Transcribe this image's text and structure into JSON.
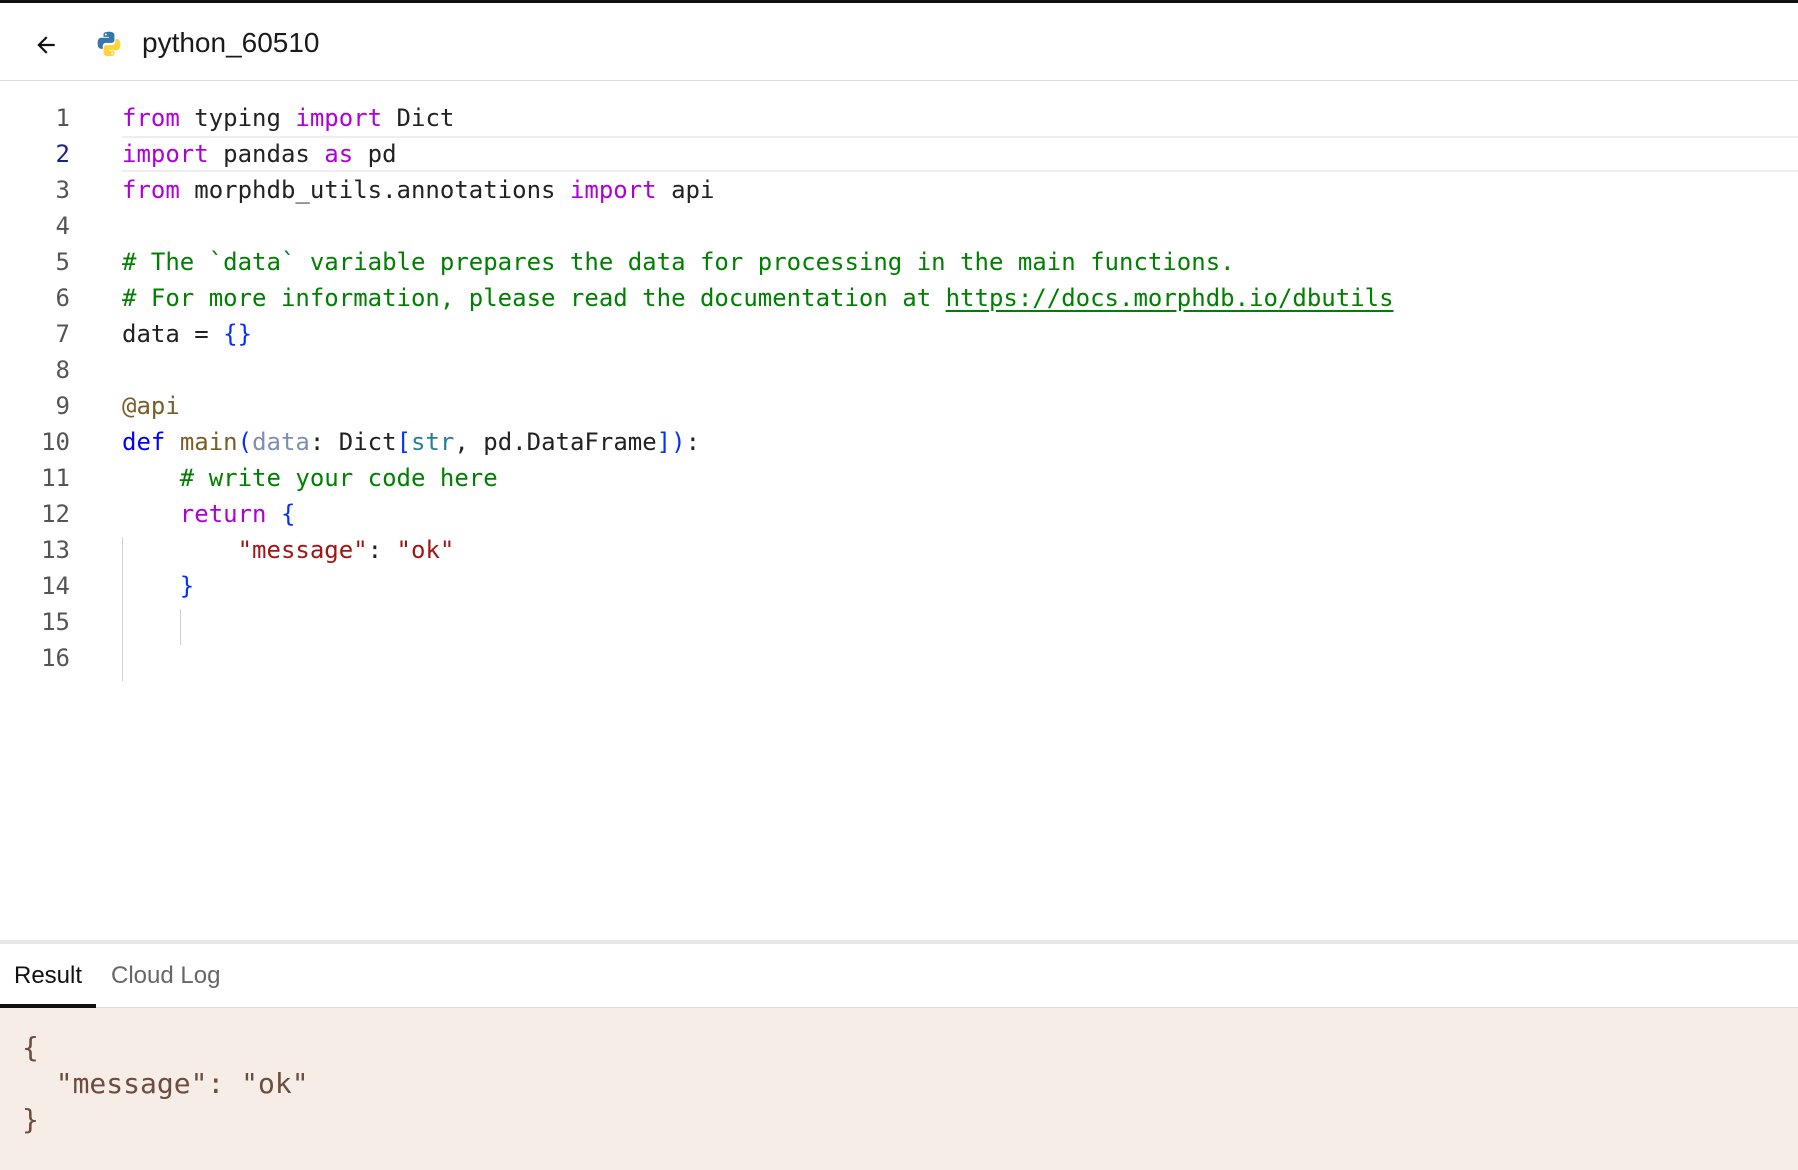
{
  "header": {
    "file_name": "python_60510",
    "back_icon": "arrow-left-icon",
    "file_icon": "python-icon"
  },
  "editor": {
    "current_line": 2,
    "lines": [
      {
        "n": "1",
        "tokens": [
          [
            "kw",
            "from"
          ],
          [
            "pl",
            " typing "
          ],
          [
            "kw",
            "import"
          ],
          [
            "pl",
            " Dict"
          ]
        ]
      },
      {
        "n": "2",
        "tokens": [
          [
            "kw",
            "import"
          ],
          [
            "pl",
            " pandas "
          ],
          [
            "kw",
            "as"
          ],
          [
            "pl",
            " pd"
          ]
        ]
      },
      {
        "n": "3",
        "tokens": [
          [
            "kw",
            "from"
          ],
          [
            "pl",
            " morphdb_utils.annotations "
          ],
          [
            "kw",
            "import"
          ],
          [
            "pl",
            " api"
          ]
        ]
      },
      {
        "n": "4",
        "tokens": []
      },
      {
        "n": "5",
        "tokens": [
          [
            "cm",
            "# The `data` variable prepares the data for processing in the main functions."
          ]
        ]
      },
      {
        "n": "6",
        "tokens": [
          [
            "cm",
            "# For more information, please read the documentation at "
          ],
          [
            "cm-link",
            "https://docs.morphdb.io/dbutils"
          ]
        ]
      },
      {
        "n": "7",
        "tokens": [
          [
            "pl",
            "data = "
          ],
          [
            "br",
            "{}"
          ]
        ]
      },
      {
        "n": "8",
        "tokens": []
      },
      {
        "n": "9",
        "tokens": [
          [
            "dec",
            "@api"
          ]
        ]
      },
      {
        "n": "10",
        "tokens": [
          [
            "kw2",
            "def"
          ],
          [
            "pl",
            " "
          ],
          [
            "fn",
            "main"
          ],
          [
            "br",
            "("
          ],
          [
            "param",
            "data"
          ],
          [
            "pl",
            ": Dict"
          ],
          [
            "br",
            "["
          ],
          [
            "type",
            "str"
          ],
          [
            "pl",
            ", pd.DataFrame"
          ],
          [
            "br",
            "])"
          ],
          [
            "pl",
            ":"
          ]
        ]
      },
      {
        "n": "11",
        "tokens": [
          [
            "pl",
            "    "
          ],
          [
            "cm",
            "# write your code here"
          ]
        ]
      },
      {
        "n": "12",
        "tokens": [
          [
            "pl",
            "    "
          ],
          [
            "kw",
            "return"
          ],
          [
            "pl",
            " "
          ],
          [
            "br",
            "{"
          ]
        ]
      },
      {
        "n": "13",
        "tokens": [
          [
            "pl",
            "        "
          ],
          [
            "str",
            "\"message\""
          ],
          [
            "pl",
            ": "
          ],
          [
            "str",
            "\"ok\""
          ]
        ]
      },
      {
        "n": "14",
        "tokens": [
          [
            "pl",
            "    "
          ],
          [
            "br",
            "}"
          ]
        ]
      },
      {
        "n": "15",
        "tokens": []
      },
      {
        "n": "16",
        "tokens": []
      }
    ]
  },
  "tabs": [
    {
      "label": "Result",
      "active": true
    },
    {
      "label": "Cloud Log",
      "active": false
    }
  ],
  "result": {
    "lines": [
      "{",
      "  \"message\": \"ok\"",
      "}"
    ]
  }
}
